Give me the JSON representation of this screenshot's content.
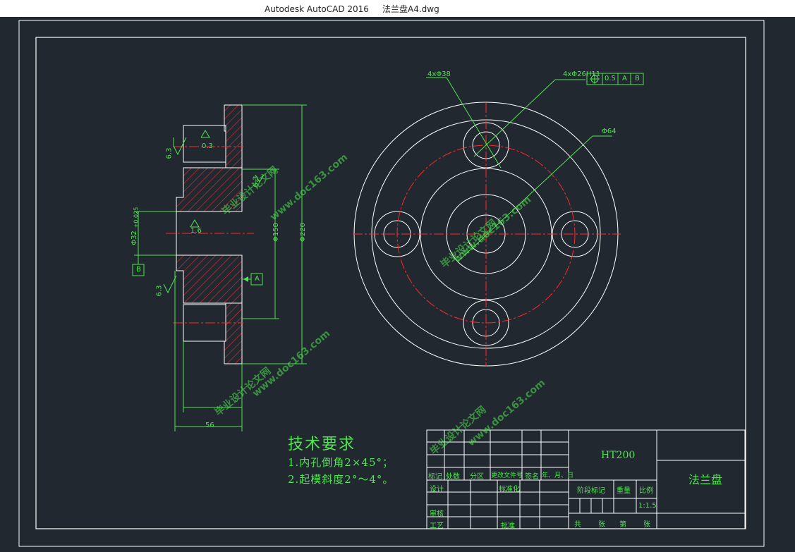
{
  "window": {
    "title": "Autodesk AutoCAD 2016     法兰盘A4.dwg"
  },
  "colors": {
    "background": "#212830",
    "outline": "#ffffff",
    "dimension": "#4fe64f",
    "centerline": "#ff2a2a",
    "hatch": "#e03030"
  },
  "dimensions": {
    "d1": "4xΦ38",
    "d2": "4xΦ26H11",
    "tol_value": "0.5",
    "tol_ref_a": "A",
    "tol_ref_b": "B",
    "d3": "Φ64",
    "d4": "Φ150",
    "d5": "Φ220",
    "d6": "Φ32",
    "d6_tol": "+0.025",
    "width": "56",
    "rough1": "6.3",
    "rough2": "6.3",
    "rough3": "6.3",
    "rough_top": "0.3",
    "rough_mid": "1.6",
    "datum_a": "A",
    "datum_b": "B"
  },
  "tech": {
    "title": "技术要求",
    "item1": "1.内孔倒角2×45°；",
    "item2": "2.起模斜度2°～4°。"
  },
  "titleblock": {
    "material": "HT200",
    "part_name": "法兰盘",
    "h_mark": "标记",
    "h_count": "处数",
    "h_zone": "分区",
    "h_docno": "更改文件号",
    "h_sign": "签名",
    "h_date": "年、月、日",
    "design": "设计",
    "standard": "标准化",
    "stage": "阶段标记",
    "weight": "重量",
    "scale": "比例",
    "scale_value": "1:1.5",
    "review": "审核",
    "process": "工艺",
    "approve": "批准",
    "total": "共",
    "sheets": "张",
    "sheet_no": "第",
    "sheet": "张"
  },
  "watermark": {
    "site": "www.doc163.com",
    "brand": "毕业设计论文网"
  }
}
